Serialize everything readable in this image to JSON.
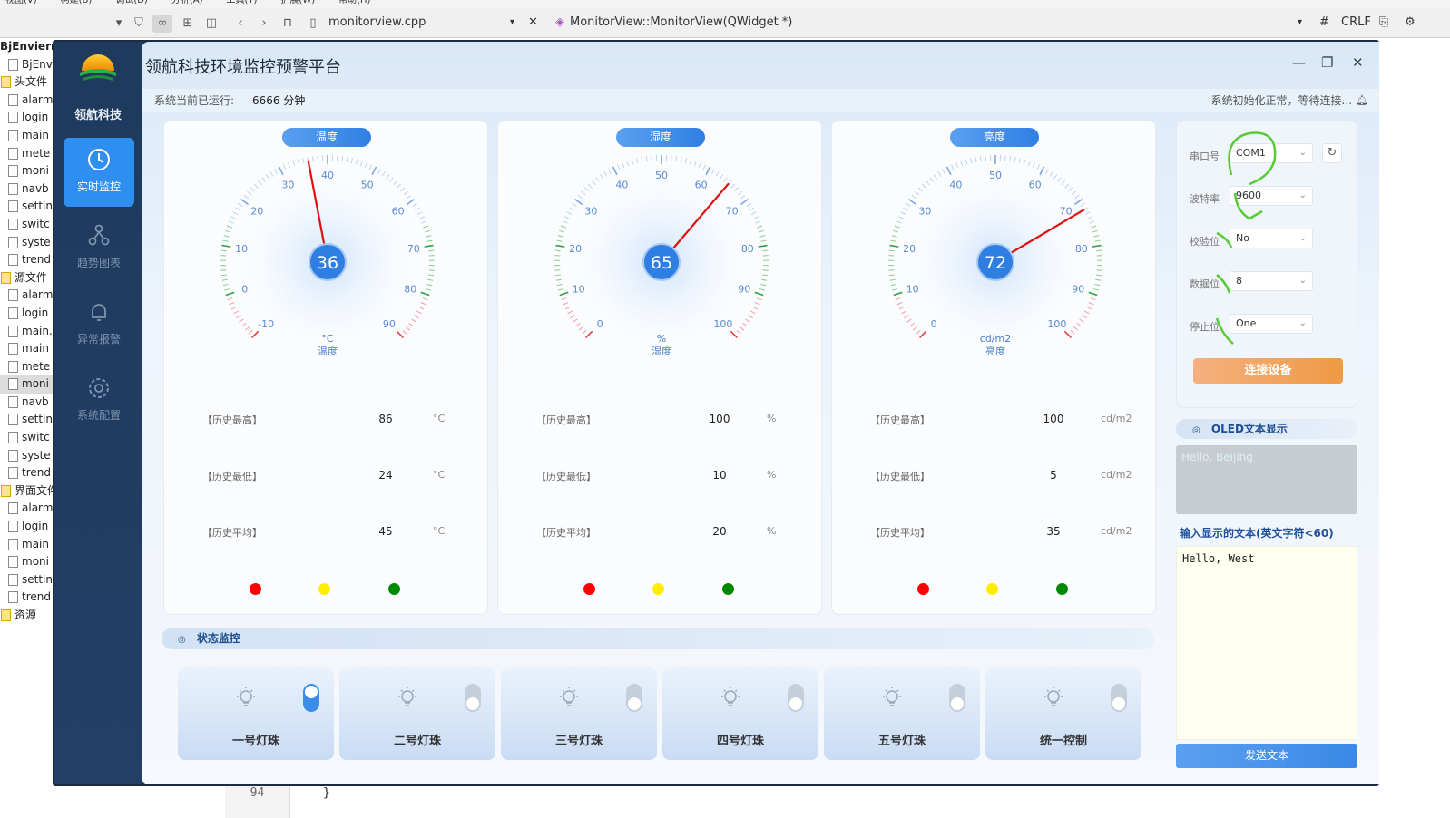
{
  "ide": {
    "menu": [
      "视图(V)",
      "构建(B)",
      "调试(D)",
      "分析(A)",
      "工具(T)",
      "扩展(W)",
      "帮助(H)"
    ],
    "file_name": "monitorview.cpp",
    "function_name": "MonitorView::MonitorView(QWidget *)",
    "hash_label": "#",
    "line_ending": "CRLF",
    "tree": [
      {
        "label": "BjEnvierm",
        "kind": "root"
      },
      {
        "label": "BjEnvier",
        "kind": "file"
      },
      {
        "label": "头文件",
        "kind": "group"
      },
      {
        "label": "alarm",
        "kind": "file"
      },
      {
        "label": "login",
        "kind": "file"
      },
      {
        "label": "main",
        "kind": "file"
      },
      {
        "label": "mete",
        "kind": "file"
      },
      {
        "label": "moni",
        "kind": "file"
      },
      {
        "label": "navb",
        "kind": "file"
      },
      {
        "label": "settin",
        "kind": "file"
      },
      {
        "label": "switc",
        "kind": "file"
      },
      {
        "label": "syste",
        "kind": "file"
      },
      {
        "label": "trend",
        "kind": "file"
      },
      {
        "label": "源文件",
        "kind": "group"
      },
      {
        "label": "alarm",
        "kind": "file"
      },
      {
        "label": "login",
        "kind": "file"
      },
      {
        "label": "main.",
        "kind": "file"
      },
      {
        "label": "main",
        "kind": "file"
      },
      {
        "label": "mete",
        "kind": "file"
      },
      {
        "label": "moni",
        "kind": "file",
        "selected": true
      },
      {
        "label": "navb",
        "kind": "file"
      },
      {
        "label": "settin",
        "kind": "file"
      },
      {
        "label": "switc",
        "kind": "file"
      },
      {
        "label": "syste",
        "kind": "file"
      },
      {
        "label": "trend",
        "kind": "file"
      },
      {
        "label": "界面文件",
        "kind": "group"
      },
      {
        "label": "alarm",
        "kind": "file"
      },
      {
        "label": "login",
        "kind": "file"
      },
      {
        "label": "main",
        "kind": "file"
      },
      {
        "label": "moni",
        "kind": "file"
      },
      {
        "label": "settin",
        "kind": "file"
      },
      {
        "label": "trend",
        "kind": "file"
      },
      {
        "label": "资源",
        "kind": "group"
      }
    ],
    "code_line_number": "94",
    "code_text": "}"
  },
  "app": {
    "brand": "领航科技",
    "title": "领航科技环境监控预警平台",
    "nav": [
      {
        "label": "实时监控",
        "icon": "dashboard-icon",
        "active": true
      },
      {
        "label": "趋势图表",
        "icon": "share-nodes-icon",
        "active": false
      },
      {
        "label": "异常报警",
        "icon": "bell-icon",
        "active": false
      },
      {
        "label": "系统配置",
        "icon": "gear-icon",
        "active": false
      }
    ],
    "runtime_label": "系统当前已运行:",
    "runtime_value": "6666 分钟",
    "status_text": "系统初始化正常，等待连接...",
    "gauges": [
      {
        "name": "温度",
        "value": 36,
        "unit": "°C",
        "min": -10,
        "max": 90,
        "ticks": [
          "-10",
          "0",
          "10",
          "20",
          "30",
          "40",
          "50",
          "60",
          "70",
          "80",
          "90"
        ],
        "history": [
          {
            "label": "【历史最高】",
            "value": "86",
            "unit": "°C"
          },
          {
            "label": "【历史最低】",
            "value": "24",
            "unit": "°C"
          },
          {
            "label": "【历史平均】",
            "value": "45",
            "unit": "°C"
          }
        ]
      },
      {
        "name": "湿度",
        "value": 65,
        "unit": "%",
        "min": 0,
        "max": 100,
        "ticks": [
          "0",
          "10",
          "20",
          "30",
          "40",
          "50",
          "60",
          "70",
          "80",
          "90",
          "100"
        ],
        "history": [
          {
            "label": "【历史最高】",
            "value": "100",
            "unit": "%"
          },
          {
            "label": "【历史最低】",
            "value": "10",
            "unit": "%"
          },
          {
            "label": "【历史平均】",
            "value": "20",
            "unit": "%"
          }
        ]
      },
      {
        "name": "亮度",
        "value": 72,
        "unit": "cd/m2",
        "min": 0,
        "max": 100,
        "ticks": [
          "0",
          "10",
          "20",
          "30",
          "40",
          "50",
          "60",
          "70",
          "80",
          "90",
          "100"
        ],
        "history": [
          {
            "label": "【历史最高】",
            "value": "100",
            "unit": "cd/m2"
          },
          {
            "label": "【历史最低】",
            "value": "5",
            "unit": "cd/m2"
          },
          {
            "label": "【历史平均】",
            "value": "35",
            "unit": "cd/m2"
          }
        ]
      }
    ],
    "indicator_colors": [
      "#ff0000",
      "#ffee00",
      "#008800"
    ],
    "state_title": "状态监控",
    "lamps": [
      {
        "label": "一号灯珠",
        "on": true
      },
      {
        "label": "二号灯珠",
        "on": false
      },
      {
        "label": "三号灯珠",
        "on": false
      },
      {
        "label": "四号灯珠",
        "on": false
      },
      {
        "label": "五号灯珠",
        "on": false
      },
      {
        "label": "统一控制",
        "on": false
      }
    ],
    "serial": {
      "port_label": "串口号",
      "port_value": "COM1",
      "baud_label": "波特率",
      "baud_value": "9600",
      "parity_label": "校验位",
      "parity_value": "No",
      "data_label": "数据位",
      "data_value": "8",
      "stop_label": "停止位",
      "stop_value": "One",
      "connect_label": "连接设备"
    },
    "oled": {
      "title": "OLED文本显示",
      "display_text": "Hello, Beijing",
      "input_label": "输入显示的文本(英文字符<60)",
      "input_value": "Hello, West",
      "send_label": "发送文本"
    },
    "accent_color": "#2f8ff0"
  }
}
